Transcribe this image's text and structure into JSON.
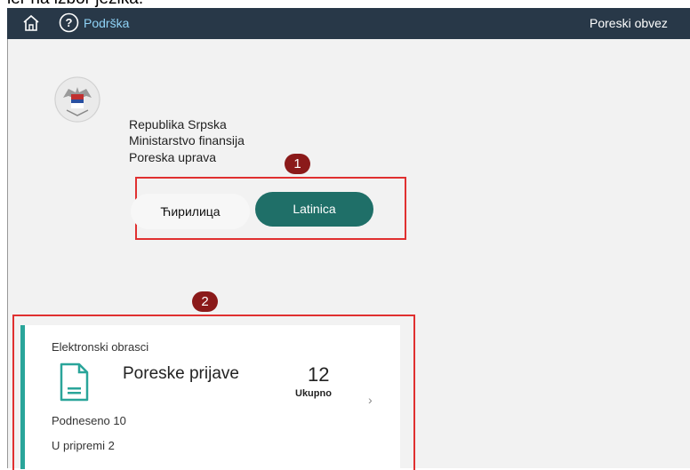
{
  "caption": "ler na izbor jezika.",
  "header": {
    "support_label": "Podrška",
    "taxpayer_label": "Poreski obvez"
  },
  "org": {
    "line1": "Republika Srpska",
    "line2": "Ministarstvo finansija",
    "line3": "Poreska uprava"
  },
  "annotations": {
    "marker1": "1",
    "marker2": "2",
    "color": "#e03030"
  },
  "language": {
    "cyrillic_label": "Ћирилица",
    "latin_label": "Latinica",
    "selected": "Latinica"
  },
  "tile": {
    "subtitle": "Elektronski obrasci",
    "title": "Poreske prijave",
    "count": "12",
    "count_label": "Ukupno",
    "submitted": "Podneseno 10",
    "in_progress": "U pripremi 2",
    "accent": "#2aa59a"
  },
  "icons": [
    "home-icon",
    "help-icon",
    "coat-of-arms-logo",
    "document-icon",
    "chevron-right-icon"
  ],
  "colors": {
    "topbar": "#283848",
    "latin_button": "#1f6f68"
  }
}
